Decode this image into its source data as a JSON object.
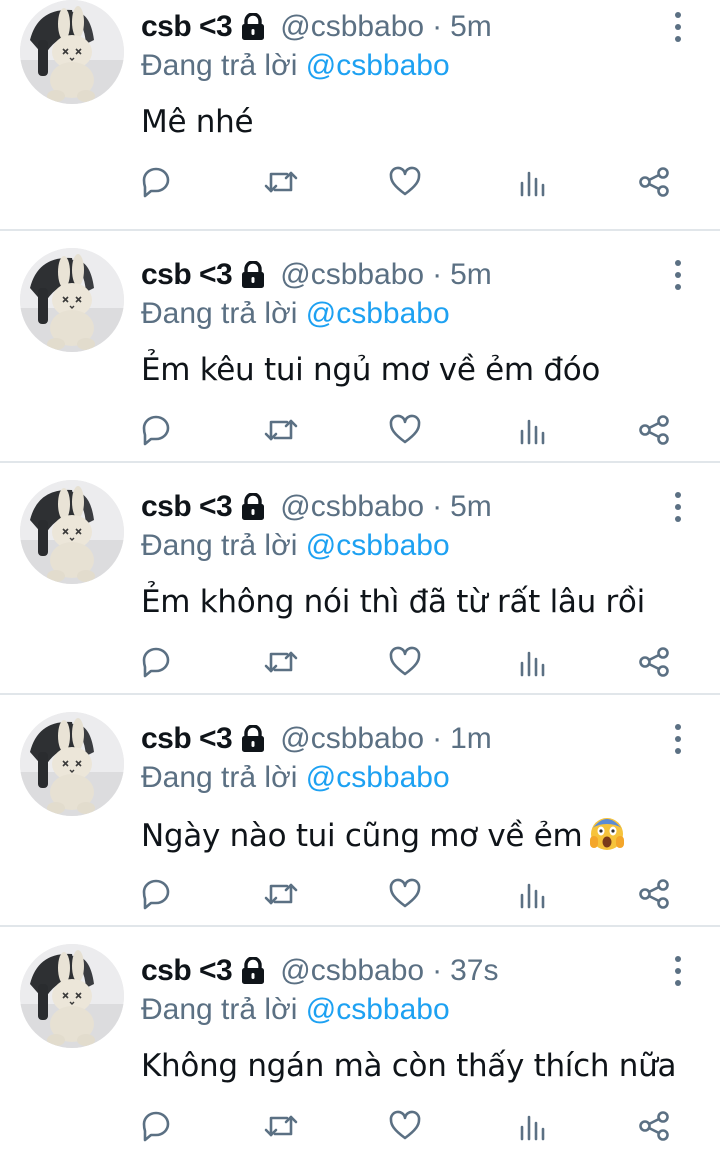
{
  "icons": {
    "reply": "speech-bubble-icon",
    "retweet": "retweet-arrows-icon",
    "like": "heart-icon",
    "stats": "bar-chart-icon",
    "share": "share-icon",
    "lock": "lock-icon",
    "more": "vertical-dots-icon"
  },
  "colors": {
    "handle": "#5b7083",
    "mention": "#1da1f2",
    "divider": "#e1e6ea"
  },
  "tweets": [
    {
      "name": "csb <3",
      "handle": "@csbbabo",
      "dot": "·",
      "time": "5m",
      "reply_prefix": "Đang trả lời",
      "reply_to": "@csbbabo",
      "text": "Mê nhé"
    },
    {
      "name": "csb <3",
      "handle": "@csbbabo",
      "dot": "·",
      "time": "5m",
      "reply_prefix": "Đang trả lời",
      "reply_to": "@csbbabo",
      "text": "Ẻm kêu tui ngủ mơ về ẻm đóo"
    },
    {
      "name": "csb <3",
      "handle": "@csbbabo",
      "dot": "·",
      "time": "5m",
      "reply_prefix": "Đang trả lời",
      "reply_to": "@csbbabo",
      "text": "Ẻm không nói thì đã từ rất lâu rồi"
    },
    {
      "name": "csb <3",
      "handle": "@csbbabo",
      "dot": "·",
      "time": "1m",
      "reply_prefix": "Đang trả lời",
      "reply_to": "@csbbabo",
      "text": "Ngày nào tui cũng mơ về ẻm",
      "emoji": "screaming-face-emoji"
    },
    {
      "name": "csb <3",
      "handle": "@csbbabo",
      "dot": "·",
      "time": "37s",
      "reply_prefix": "Đang trả lời",
      "reply_to": "@csbbabo",
      "text": "Không ngán mà còn thấy thích nữa"
    }
  ]
}
